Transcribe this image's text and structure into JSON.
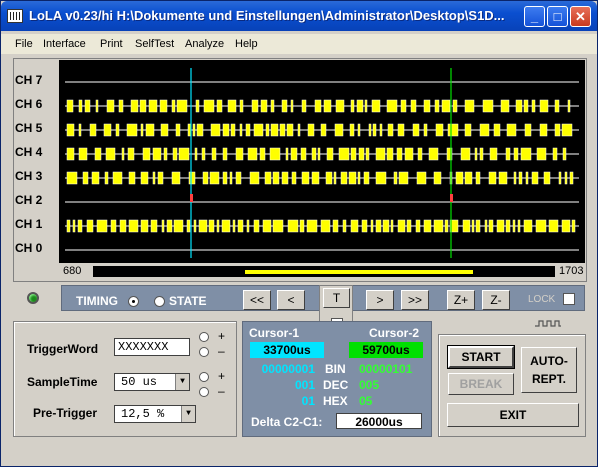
{
  "window": {
    "title": "LoLA v0.23/hi  H:\\Dokumente und Einstellungen\\Administrator\\Desktop\\S1D...",
    "minimize": "_",
    "maximize": "□",
    "close": "✕"
  },
  "menu": [
    "File",
    "Interface",
    "Print",
    "SelfTest",
    "Analyze",
    "Help"
  ],
  "channels": [
    "CH 7",
    "CH 6",
    "CH 5",
    "CH 4",
    "CH 3",
    "CH 2",
    "CH 1",
    "CH 0"
  ],
  "scope": {
    "range_start": "680",
    "range_end": "1703",
    "cursor1_color": "#00e5ff",
    "cursor2_color": "#00e000",
    "trace_color": "#ffff00"
  },
  "mode": {
    "timing_label": "TIMING",
    "state_label": "STATE",
    "selected": "TIMING"
  },
  "nav": {
    "first": "<<",
    "prev": "<",
    "trigger": "T",
    "next": ">",
    "last": ">>",
    "zoom_in": "Z+",
    "zoom_out": "Z-",
    "lock_label": "LOCK"
  },
  "settings": {
    "trigger_word_label": "TriggerWord",
    "trigger_word_value": "XXXXXXX",
    "sample_time_label": "SampleTime",
    "sample_time_value": "50 us",
    "pre_trigger_label": "Pre-Trigger",
    "pre_trigger_value": "12,5 %",
    "plus": "+",
    "minus": "–"
  },
  "cursor": {
    "cursor1_label": "Cursor-1",
    "cursor2_label": "Cursor-2",
    "cursor1_time": "33700us",
    "cursor2_time": "59700us",
    "c1_bin": "00000001",
    "c1_dec": "001",
    "c1_hex": "01",
    "c2_bin": "00000101",
    "c2_dec": "005",
    "c2_hex": "05",
    "bin_label": "BIN",
    "dec_label": "DEC",
    "hex_label": "HEX",
    "delta_label": "Delta C2-C1:",
    "delta_value": "26000us"
  },
  "buttons": {
    "start": "START",
    "break": "BREAK",
    "auto_line1": "AUTO-",
    "auto_line2": "REPT.",
    "exit": "EXIT"
  }
}
